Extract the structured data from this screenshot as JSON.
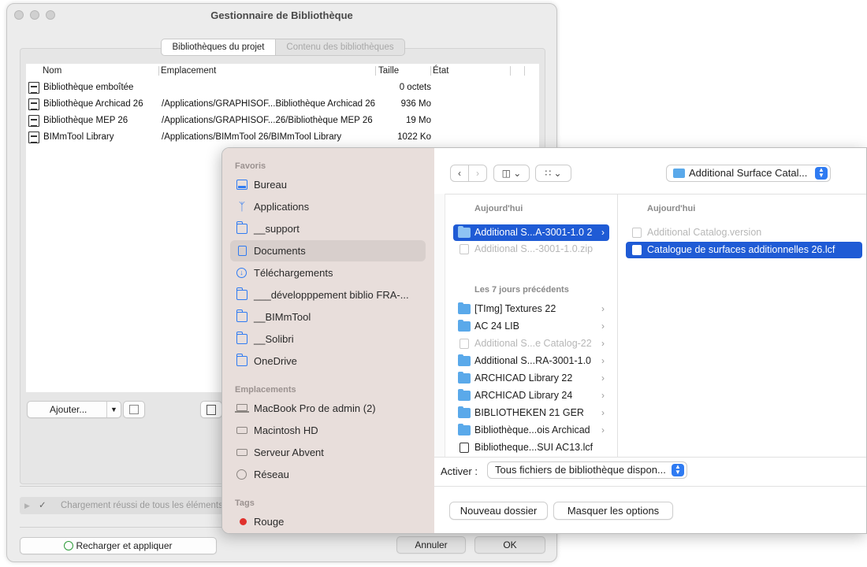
{
  "library_manager": {
    "title": "Gestionnaire de Bibliothèque",
    "tabs": [
      {
        "label": "Bibliothèques du projet",
        "active": true
      },
      {
        "label": "Contenu des bibliothèques",
        "active": false
      }
    ],
    "columns": [
      "Nom",
      "Emplacement",
      "Taille",
      "État"
    ],
    "rows": [
      {
        "name": "Bibliothèque emboîtée",
        "location": "",
        "size": "0 octets",
        "state": ""
      },
      {
        "name": "Bibliothèque Archicad 26",
        "location": "/Applications/GRAPHISOF...Bibliothèque Archicad 26",
        "size": "936 Mo",
        "state": ""
      },
      {
        "name": "Bibliothèque MEP 26",
        "location": "/Applications/GRAPHISOF...26/Bibliothèque MEP 26",
        "size": "19 Mo",
        "state": ""
      },
      {
        "name": "BIMmTool Library",
        "location": "/Applications/BIMmTool 26/BIMmTool Library",
        "size": "1022 Ko",
        "state": ""
      }
    ],
    "add_button": "Ajouter...",
    "status_text": "Chargement réussi de tous les éléments",
    "reload_button": "Recharger et appliquer",
    "cancel_button": "Annuler",
    "ok_button": "OK"
  },
  "dialog": {
    "sidebar": {
      "favorites_header": "Favoris",
      "favorites": [
        {
          "label": "Bureau",
          "icon": "desktop-icon"
        },
        {
          "label": "Applications",
          "icon": "applications-icon"
        },
        {
          "label": "__support",
          "icon": "folder-icon"
        },
        {
          "label": "Documents",
          "icon": "document-icon",
          "selected": true
        },
        {
          "label": "Téléchargements",
          "icon": "download-icon"
        },
        {
          "label": "___développpement biblio FRA-...",
          "icon": "folder-icon"
        },
        {
          "label": "__BIMmTool",
          "icon": "folder-icon"
        },
        {
          "label": "__Solibri",
          "icon": "folder-icon"
        },
        {
          "label": "OneDrive",
          "icon": "folder-icon"
        }
      ],
      "locations_header": "Emplacements",
      "locations": [
        {
          "label": "MacBook Pro de admin (2)",
          "icon": "laptop-icon"
        },
        {
          "label": "Macintosh HD",
          "icon": "drive-icon"
        },
        {
          "label": "Serveur Abvent",
          "icon": "server-icon"
        },
        {
          "label": "Réseau",
          "icon": "network-icon"
        }
      ],
      "tags_header": "Tags",
      "tags": [
        {
          "label": "Rouge",
          "color": "#e0312c"
        }
      ]
    },
    "toolbar": {
      "current_folder": "Additional Surface Catal..."
    },
    "column1": {
      "header_today": "Aujourd'hui",
      "today": [
        {
          "label": "Additional S...A-3001-1.0 2",
          "type": "folder",
          "selected": true
        },
        {
          "label": "Additional S...-3001-1.0.zip",
          "type": "zip",
          "dimmed": true
        }
      ],
      "header_week": "Les 7 jours précédents",
      "week": [
        {
          "label": "[TImg] Textures 22",
          "type": "folder"
        },
        {
          "label": "AC 24 LIB",
          "type": "folder"
        },
        {
          "label": "Additional S...e Catalog-22",
          "type": "doc",
          "dimmed": true
        },
        {
          "label": "Additional S...RA-3001-1.0",
          "type": "folder"
        },
        {
          "label": "ARCHICAD Library 22",
          "type": "folder"
        },
        {
          "label": "ARCHICAD Library 24",
          "type": "folder"
        },
        {
          "label": "BIBLIOTHEKEN 21 GER",
          "type": "folder"
        },
        {
          "label": "Bibliothèque...ois Archicad",
          "type": "folder"
        },
        {
          "label": "Bibliotheque...SUI AC13.lcf",
          "type": "lcf"
        }
      ]
    },
    "column2": {
      "header_today": "Aujourd'hui",
      "items": [
        {
          "label": "Additional Catalog.version",
          "type": "doc",
          "dimmed": true
        },
        {
          "label": "Catalogue de surfaces additionnelles 26.lcf",
          "type": "lcf",
          "selected": true
        }
      ]
    },
    "activate_label": "Activer :",
    "activate_value": "Tous fichiers de bibliothèque dispon...",
    "new_folder_button": "Nouveau dossier",
    "hide_options_button": "Masquer les options"
  }
}
